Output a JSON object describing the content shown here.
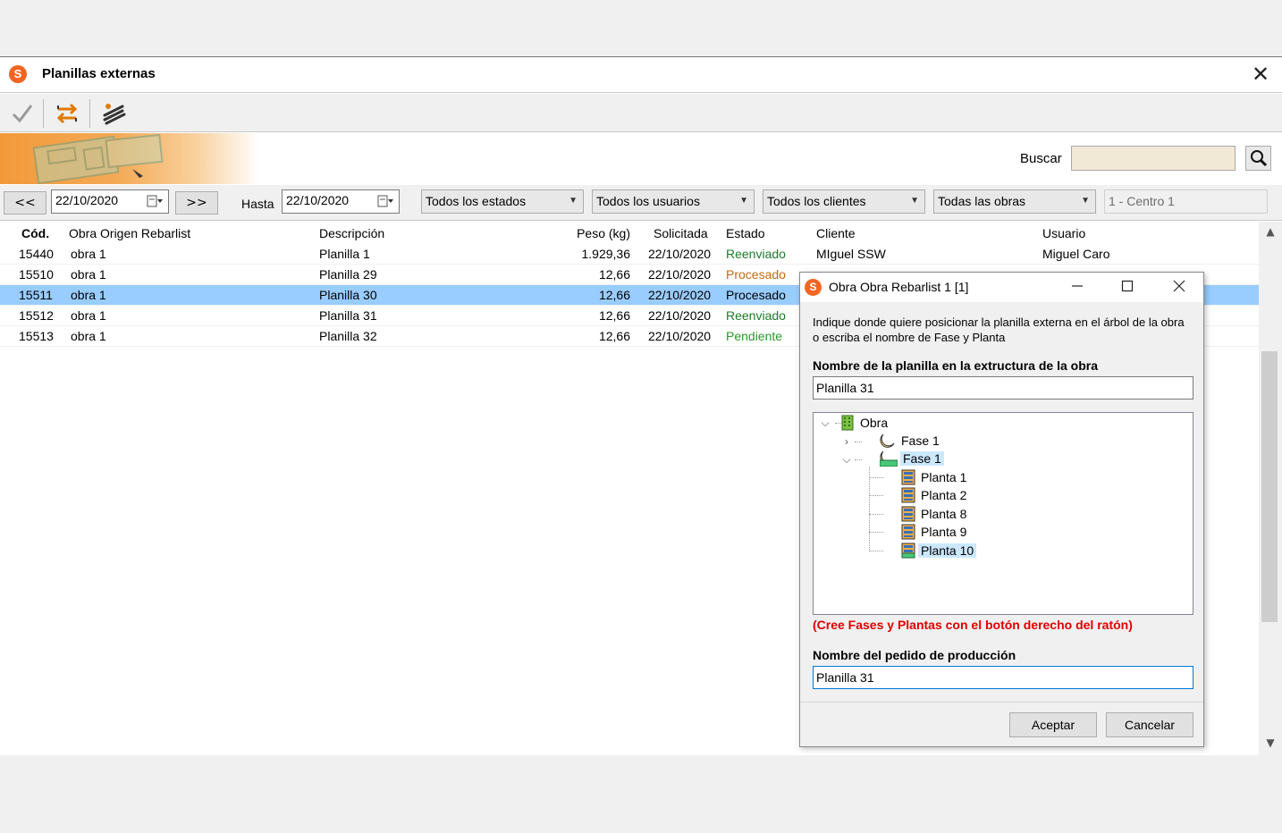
{
  "window": {
    "title": "Planillas externas",
    "logo_letter": "S",
    "close_glyph": "✕"
  },
  "search": {
    "label": "Buscar",
    "value": ""
  },
  "filters": {
    "prev_label": "<<",
    "next_label": ">>",
    "date_from": "22/10/2020",
    "hasta_label": "Hasta",
    "date_to": "22/10/2020",
    "estado": "Todos los estados",
    "usuario": "Todos los usuarios",
    "cliente": "Todos los clientes",
    "obra": "Todas las obras",
    "centro": "1 - Centro 1"
  },
  "grid": {
    "columns": [
      "Cód.",
      "Obra Origen Rebarlist",
      "Descripción",
      "Peso (kg)",
      "Solicitada",
      "Estado",
      "Cliente",
      "Usuario"
    ],
    "rows": [
      {
        "cod": "15440",
        "obra": "obra 1",
        "desc": "Planilla 1",
        "peso": "1.929,36",
        "fecha": "22/10/2020",
        "estado": "Reenviado",
        "cliente": "MIguel SSW",
        "usuario": "Miguel Caro"
      },
      {
        "cod": "15510",
        "obra": "obra 1",
        "desc": "Planilla 29",
        "peso": "12,66",
        "fecha": "22/10/2020",
        "estado": "Procesado",
        "cliente": "",
        "usuario": ""
      },
      {
        "cod": "15511",
        "obra": "obra 1",
        "desc": "Planilla 30",
        "peso": "12,66",
        "fecha": "22/10/2020",
        "estado": "Procesado",
        "cliente": "",
        "usuario": ""
      },
      {
        "cod": "15512",
        "obra": "obra 1",
        "desc": "Planilla 31",
        "peso": "12,66",
        "fecha": "22/10/2020",
        "estado": "Reenviado",
        "cliente": "",
        "usuario": ""
      },
      {
        "cod": "15513",
        "obra": "obra 1",
        "desc": "Planilla 32",
        "peso": "12,66",
        "fecha": "22/10/2020",
        "estado": "Pendiente",
        "cliente": "",
        "usuario": ""
      }
    ]
  },
  "dialog": {
    "title": "Obra Obra Rebarlist 1 [1]",
    "instructions": "Indique donde quiere posicionar la planilla externa en el árbol de la obra o escriba el nombre de Fase y Planta",
    "name_label": "Nombre de la planilla en la extructura de la obra",
    "name_value": "Planilla 31",
    "tree": {
      "root": "Obra",
      "fases": [
        {
          "label": "Fase 1",
          "expanded": false
        },
        {
          "label": "Fase 1",
          "expanded": true,
          "plantas": [
            "Planta 1",
            "Planta 2",
            "Planta 8",
            "Planta 9",
            "Planta 10"
          ]
        }
      ]
    },
    "warning": "(Cree Fases y Plantas con el botón derecho del ratón)",
    "order_label": "Nombre del pedido de producción",
    "order_value": "Planilla 31",
    "accept": "Aceptar",
    "cancel": "Cancelar"
  },
  "colors": {
    "accent": "#f26522",
    "selection": "#99ccff",
    "warning": "#e00000"
  }
}
